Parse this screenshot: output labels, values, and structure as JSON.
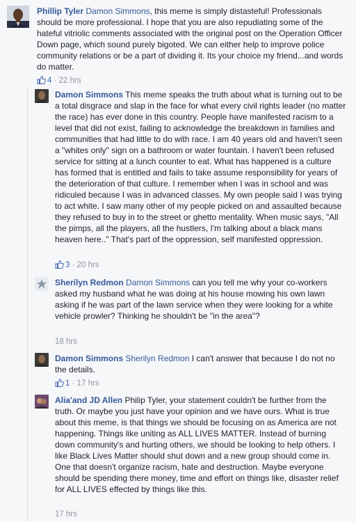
{
  "comments": [
    {
      "author": "Phillip Tyler",
      "mention": "Damon Simmons",
      "text": ", this meme is simply distasteful! Professionals should be more professional. I hope that you are also repudiating some of the hateful vitriolic comments associated with the original post on the Operation Officer Down page, which sound purely bigoted. We can either help to improve police community relations or be a part of dividing it. Its your choice my friend...and words do matter.",
      "likes": "4",
      "time": "22 hrs"
    },
    {
      "author": "Damon Simmons",
      "mention": "",
      "text": "This meme speaks the truth about what is turning out to be a total disgrace and slap in the face for what every civil rights leader (no matter the race) has ever done in this country. People have manifested racism to a level that did not exist, failing to acknowledge the breakdown in families and communities that had little to do with race. I am 40 years old and haven't seen a \"whites only\" sign on a bathroom or water fountain. I haven't been refused service for sitting at a lunch counter to eat. What has happened is a culture has formed that is entitled and fails to take assume responsibility for years of the deterioration of that culture. I remember when I was in school and was ridiculed because I was in advanced classes. My own people said I was trying to act white. I saw many other of my people picked on and assaulted because they refused to buy in to the street or ghetto mentality. When music says, \"All the pimps, all the players, all the hustlers, I'm talking about a black mans heaven here..\" That's part of the oppression, self manifested oppression.",
      "likes": "3",
      "time": "20 hrs"
    },
    {
      "author": "Sherilyn Redmon",
      "mention": "Damon Simmons",
      "text": " can you tell me why your co-workers asked my husband what he was doing at his house mowing his own lawn asking if he was part of the lawn service when they were looking for a white vehicle prowler? Thinking he shouldn't be \"in the area\"?",
      "likes": "",
      "time": "18 hrs"
    },
    {
      "author": "Damon Simmons",
      "mention": "Sherilyn Redmon",
      "text": " I can't answer that because I do not no the details.",
      "likes": "1",
      "time": "17 hrs"
    },
    {
      "author": "Alia'and JD Allen",
      "mention": "",
      "text": "Philip Tyler, your statement couldn't be further from the truth. Or maybe you just have your opinion and we have ours. What is true about this meme, is that things we should be focusing on as America are not happening. Things like uniting as ALL LIVES MATTER. Instead of burning down community's and hurting others, we should be looking to help others. I like Black Lives Matter should shut down and a new group should come in. One that doesn't organize racism, hate and destruction. Maybe everyone should be spending there money, time and effort on things like, disaster relief for ALL LIVES effected by things like this.",
      "likes": "",
      "time": "17 hrs"
    }
  ],
  "separator": " · ",
  "colors": {
    "link": "#365899",
    "meta": "#90949c",
    "like": "#4267b2",
    "background": "#f6f7f9"
  }
}
